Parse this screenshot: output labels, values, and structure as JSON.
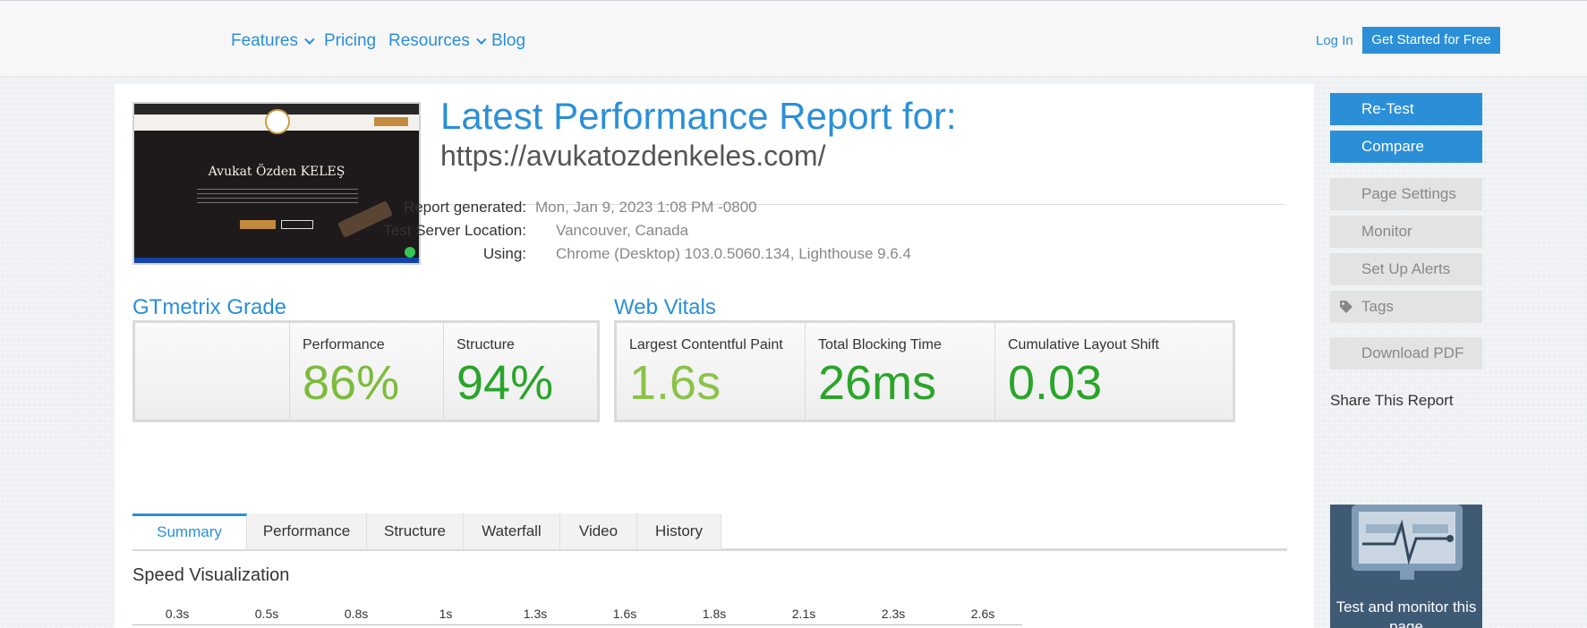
{
  "nav": {
    "items": [
      {
        "label": "Features",
        "dropdown": true
      },
      {
        "label": "Pricing",
        "dropdown": false
      },
      {
        "label": "Resources",
        "dropdown": true
      },
      {
        "label": "Blog",
        "dropdown": false
      }
    ],
    "login": "Log In",
    "cta": "Get Started for Free"
  },
  "thumbnail": {
    "site_title": "Avukat Özden KELEŞ"
  },
  "report": {
    "title": "Latest Performance Report for:",
    "url": "https://avukatozdenkeles.com/",
    "generated_label": "Report generated:",
    "generated_value": "Mon, Jan 9, 2023 1:08 PM -0800",
    "location_label": "Test Server Location:",
    "location_value": "Vancouver, Canada",
    "using_label": "Using:",
    "using_value": "Chrome (Desktop) 103.0.5060.134, Lighthouse 9.6.4"
  },
  "grade": {
    "title": "GTmetrix Grade",
    "performance_label": "Performance",
    "performance_value": "86%",
    "structure_label": "Structure",
    "structure_value": "94%"
  },
  "vitals": {
    "title": "Web Vitals",
    "lcp_label": "Largest Contentful Paint",
    "lcp_value": "1.6s",
    "tbt_label": "Total Blocking Time",
    "tbt_value": "26ms",
    "cls_label": "Cumulative Layout Shift",
    "cls_value": "0.03"
  },
  "tabs": [
    "Summary",
    "Performance",
    "Structure",
    "Waterfall",
    "Video",
    "History"
  ],
  "speed": {
    "title": "Speed Visualization",
    "ticks": [
      "0.3s",
      "0.5s",
      "0.8s",
      "1s",
      "1.3s",
      "1.6s",
      "1.8s",
      "2.1s",
      "2.3s",
      "2.6s"
    ]
  },
  "sidebar": {
    "retest": "Re-Test",
    "compare": "Compare",
    "page_settings": "Page Settings",
    "monitor": "Monitor",
    "alerts": "Set Up Alerts",
    "tags": "Tags",
    "download": "Download PDF",
    "share": "Share This Report",
    "promo_text": "Test and monitor this page"
  },
  "colors": {
    "brand": "#2b8fd8",
    "grade_a": "#2aa52a",
    "grade_b": "#7dbb3c",
    "lcp_green": "#8bc34a"
  },
  "icons": [
    "chevron-down-icon",
    "tag-icon",
    "monitor-icon"
  ]
}
